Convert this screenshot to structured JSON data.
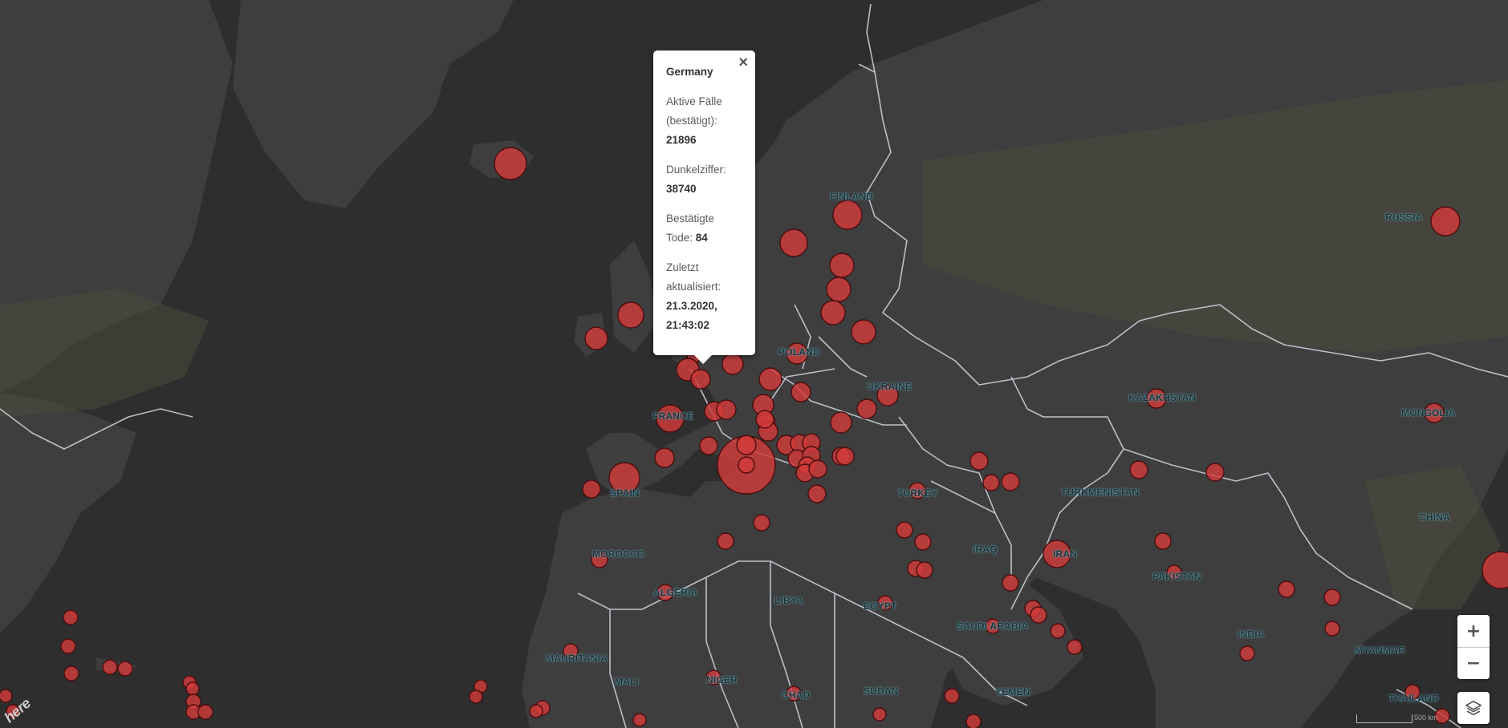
{
  "popup": {
    "country": "Germany",
    "active_label": "Aktive Fälle (bestätigt):",
    "active_value": "21896",
    "dark_label": "Dunkelziffer:",
    "dark_value": "38740",
    "deaths_label": "Bestätigte Tode:",
    "deaths_value": "84",
    "updated_label": "Zuletzt aktualisiert:",
    "updated_value": "21.3.2020, 21:43:02",
    "close_symbol": "×"
  },
  "controls": {
    "zoom_in": "+",
    "zoom_out": "−",
    "scale_text": "500 km",
    "logo_text": "here"
  },
  "labels": {
    "finland": "FINLAND",
    "russia": "RUSSIA",
    "poland": "POLAND",
    "ukraine": "UKRAINE",
    "france": "FRANCE",
    "spain": "SPAIN",
    "kazakhstan": "KAZAKHSTAN",
    "mongolia": "MONGOLIA",
    "turkey": "TURKEY",
    "turkmenistan": "TURKMENISTAN",
    "china": "CHINA",
    "morocco": "MOROCCO",
    "iraq": "IRAQ",
    "iran": "IRAN",
    "pakistan": "PAKISTAN",
    "algeria": "ALGERIA",
    "libya": "LIBYA",
    "egypt": "EGYPT",
    "saudi_arabia": "SAUDI ARABIA",
    "india": "INDIA",
    "myanmar": "MYANMAR",
    "mauritania": "MAURITANIA",
    "mali": "MALI",
    "niger": "NIGER",
    "chad": "CHAD",
    "sudan": "SUDAN",
    "yemen": "YEMEN",
    "thailand": "THAILAND"
  },
  "colors": {
    "marker_fill": "#d13a3a",
    "marker_stroke": "#4a0d0d",
    "land": "#3f3f3f",
    "water": "#2e2e2e",
    "border": "#c9cdd8"
  }
}
